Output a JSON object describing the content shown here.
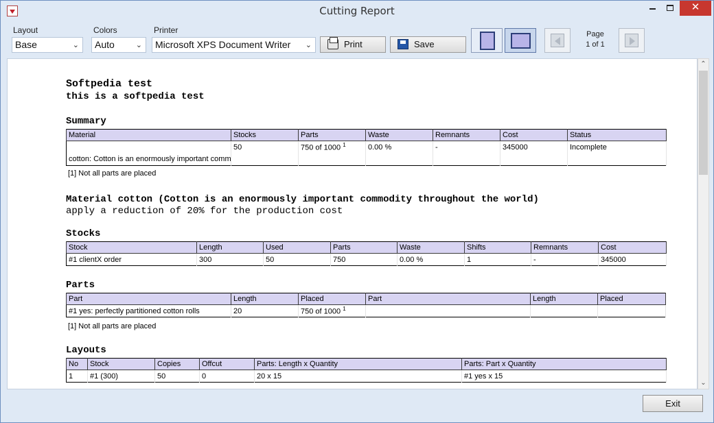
{
  "window": {
    "title": "Cutting Report",
    "minimize": "",
    "maximize": "",
    "close": "✕"
  },
  "toolbar": {
    "layout_label": "Layout",
    "layout_value": "Base",
    "colors_label": "Colors",
    "colors_value": "Auto",
    "printer_label": "Printer",
    "printer_value": "Microsoft XPS Document Writer",
    "print_label": "Print",
    "save_label": "Save",
    "page_label": "Page",
    "page_value": "1 of 1"
  },
  "report": {
    "title": "Softpedia test",
    "subtitle": "this is a softpedia test",
    "summary": {
      "heading": "Summary",
      "columns": [
        "Material",
        "Stocks",
        "Parts",
        "Waste",
        "Remnants",
        "Cost",
        "Status"
      ],
      "row1": [
        "",
        "50",
        "750 of 1000",
        "0.00 %",
        "-",
        "345000",
        "Incomplete"
      ],
      "parts_footnote_mark": "1",
      "row2_material": "cotton: Cotton is an enormously important commc",
      "note": "[1] Not all parts are placed"
    },
    "material": {
      "heading": "Material cotton (Cotton is an enormously important commodity throughout the world)",
      "line": "apply a reduction of 20% for the production cost"
    },
    "stocks": {
      "heading": "Stocks",
      "columns": [
        "Stock",
        "Length",
        "Used",
        "Parts",
        "Waste",
        "Shifts",
        "Remnants",
        "Cost"
      ],
      "row": [
        "#1 clientX order",
        "300",
        "50",
        "750",
        "0.00 %",
        "1",
        "-",
        "345000"
      ]
    },
    "parts": {
      "heading": "Parts",
      "columns": [
        "Part",
        "Length",
        "Placed",
        "Part",
        "Length",
        "Placed"
      ],
      "row": [
        "#1 yes: perfectly partitioned cotton rolls",
        "20",
        "750 of 1000",
        "",
        "",
        ""
      ],
      "placed_footnote_mark": "1",
      "note": "[1] Not all parts are placed"
    },
    "layouts": {
      "heading": "Layouts",
      "columns": [
        "No",
        "Stock",
        "Copies",
        "Offcut",
        "Parts: Length x Quantity",
        "Parts: Part x Quantity"
      ],
      "row": [
        "1",
        "#1 (300)",
        "50",
        "0",
        "20 x 15",
        "#1 yes x 15"
      ]
    }
  },
  "footer": {
    "exit_label": "Exit"
  },
  "colors": {
    "header_fill": "#d8d4f2",
    "chrome": "#dfe9f5",
    "close_button": "#c7372f"
  },
  "icons": [
    "app-icon",
    "minimize-icon",
    "maximize-icon",
    "close-icon",
    "chevron-down-icon",
    "printer-icon",
    "floppy-save-icon",
    "page-portrait-icon",
    "page-landscape-icon",
    "previous-page-icon",
    "next-page-icon",
    "scroll-up-icon",
    "scroll-down-icon"
  ]
}
